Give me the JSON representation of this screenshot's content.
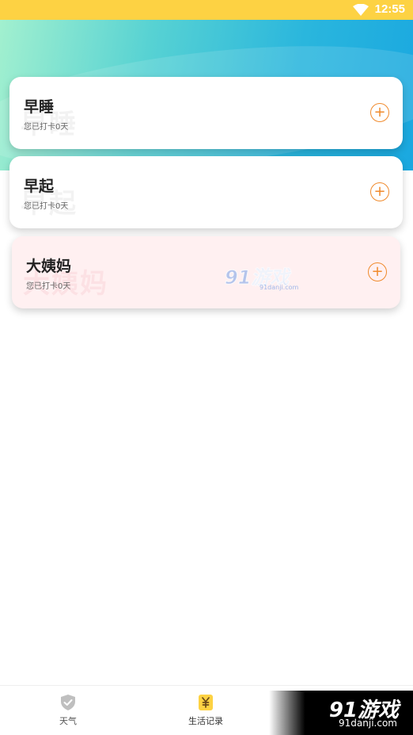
{
  "status_bar": {
    "time": "12:55",
    "wifi_icon": "wifi-icon",
    "background": "#fdd243"
  },
  "cards": [
    {
      "title": "早睡",
      "subtitle": "您已打卡0天",
      "action_icon": "plus-circle-icon",
      "action_label": "+"
    },
    {
      "title": "早起",
      "subtitle": "您已打卡0天",
      "action_icon": "plus-circle-icon",
      "action_label": "+"
    },
    {
      "title": "大姨妈",
      "subtitle": "您已打卡0天",
      "action_icon": "plus-circle-icon",
      "action_label": "+"
    }
  ],
  "watermark": {
    "logo_text": "91游戏",
    "site": "91danji.com"
  },
  "bottom_nav": {
    "items": [
      {
        "label": "天气",
        "icon": "shield-check-icon",
        "active": false
      },
      {
        "label": "生活记录",
        "icon": "yen-ticket-icon",
        "active": true
      }
    ]
  },
  "colors": {
    "accent": "#f08a2c",
    "header_gradient_start": "#a2f0cf",
    "header_gradient_end": "#1aa8e0",
    "pink_card": "#fff0f1"
  }
}
